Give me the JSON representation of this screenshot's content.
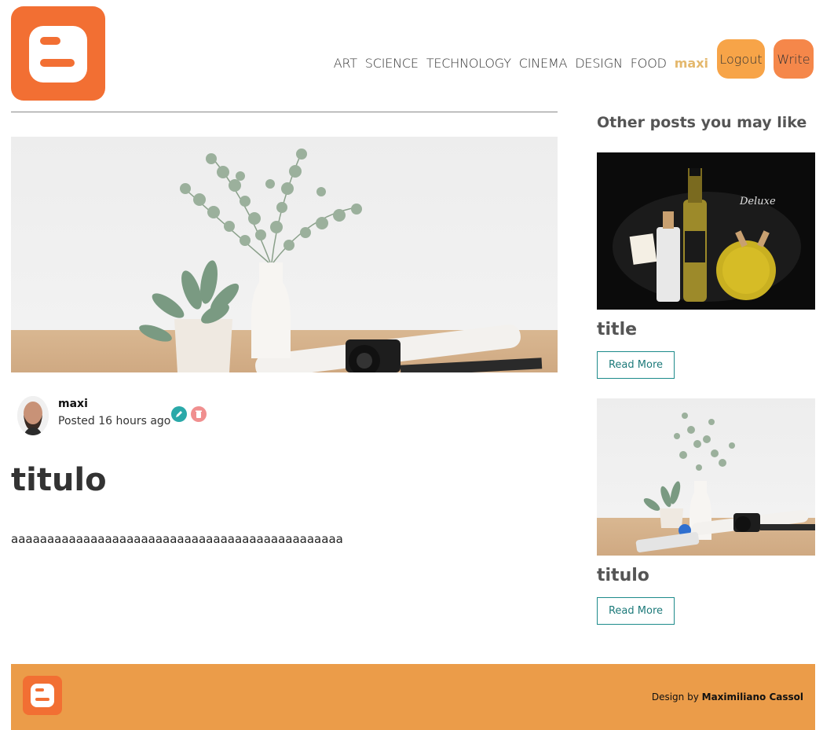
{
  "header": {
    "logo_icon": "blogger-logo-icon",
    "nav": [
      "ART",
      "SCIENCE",
      "TECHNOLOGY",
      "CINEMA",
      "DESIGN",
      "FOOD"
    ],
    "username": "maxi",
    "logout_label": "Logout",
    "write_label": "Write"
  },
  "post": {
    "image": "plant-vase-camera-photo",
    "author_name": "maxi",
    "posted": "Posted 16 hours ago",
    "edit_icon": "edit-icon",
    "delete_icon": "trash-icon",
    "title": "titulo",
    "body": "aaaaaaaaaaaaaaaaaaaaaaaaaaaaaaaaaaaaaaaaaaaaaa"
  },
  "sidebar": {
    "heading": "Other posts you may like",
    "posts": [
      {
        "title": "title",
        "image": "oil-bottles-photo",
        "read_more": "Read More"
      },
      {
        "title": "titulo",
        "image": "plant-vase-camera-photo",
        "read_more": "Read More"
      }
    ]
  },
  "footer": {
    "prefix": "Design by",
    "author": "Maximiliano Cassol"
  },
  "colors": {
    "logo_orange": "#f26f33",
    "logout_bg": "#f7a448",
    "write_bg": "#f5874a",
    "username_color": "#e4b86d",
    "footer_bg": "#eb9c49",
    "read_more_border": "#1d8b8b"
  }
}
